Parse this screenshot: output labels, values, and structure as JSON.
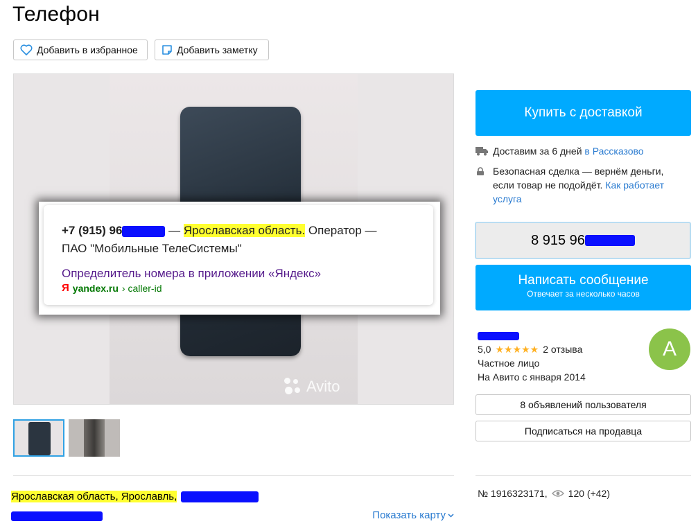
{
  "title": "Телефон",
  "actions": {
    "favorite_label": "Добавить в избранное",
    "note_label": "Добавить заметку"
  },
  "popup": {
    "phone_prefix": "+7 (915) 96",
    "dash": "—",
    "region": "Ярославская область.",
    "operator_label": "Оператор —",
    "operator_name": "ПАО \"Мобильные ТелеСистемы\"",
    "link_title": "Определитель номера в приложении «Яндекс»",
    "ya_letter": "Я",
    "url_domain": "yandex.ru",
    "url_path": "› caller-id"
  },
  "watermark": "Avito",
  "purchase": {
    "buy_label": "Купить с доставкой",
    "delivery_text": "Доставим за 6 дней",
    "delivery_city": "в Рассказово",
    "safe_text": "Безопасная сделка — вернём деньги, если товар не подойдёт.",
    "safe_link": "Как работает услуга"
  },
  "phone_button": {
    "number_prefix": "8 915 96"
  },
  "message_button": {
    "label": "Написать сообщение",
    "sub": "Отвечает за несколько часов"
  },
  "seller": {
    "rating": "5,0",
    "stars": "★★★★★",
    "reviews": "2 отзыва",
    "type": "Частное лицо",
    "since": "На Авито с января 2014",
    "avatar_letter": "A"
  },
  "seller_actions": {
    "ads_label": "8 объявлений пользователя",
    "subscribe_label": "Подписаться на продавца"
  },
  "location": {
    "address": "Ярославская область, Ярославль,",
    "show_map": "Показать карту"
  },
  "listing_meta": {
    "number": "№ 1916323171,",
    "views": "120 (+42)"
  },
  "colors": {
    "accent": "#00aaff",
    "link": "#2a7bd0",
    "highlight": "#ffff30",
    "redaction": "#0a10ff",
    "avatar": "#8bc34a"
  }
}
